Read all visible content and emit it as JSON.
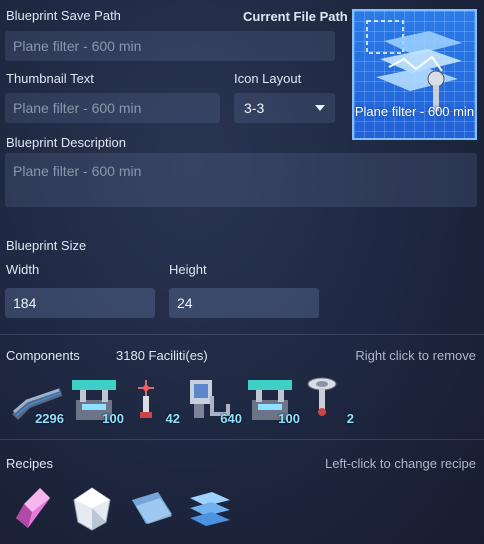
{
  "save_path": {
    "label": "Blueprint Save Path",
    "placeholder": "Plane filter - 600 min"
  },
  "current_file_path": {
    "label": "Current File Path"
  },
  "thumbnail": {
    "label": "Thumbnail Text",
    "placeholder": "Plane filter - 600 min",
    "preview_text": "Plane filter - 600 min"
  },
  "icon_layout": {
    "label": "Icon Layout",
    "value": "3-3"
  },
  "description": {
    "label": "Blueprint Description",
    "placeholder": "Plane filter - 600 min"
  },
  "size": {
    "label": "Blueprint Size",
    "width_label": "Width",
    "width_value": "184",
    "height_label": "Height",
    "height_value": "24"
  },
  "components": {
    "label": "Components",
    "facilities": "3180 Faciliti(es)",
    "hint": "Right click to remove",
    "items": [
      {
        "icon": "conveyor-belt-icon",
        "count": "2296"
      },
      {
        "icon": "sorter-machine-icon",
        "count": "100"
      },
      {
        "icon": "tesla-tower-icon",
        "count": "42"
      },
      {
        "icon": "storage-box-icon",
        "count": "640"
      },
      {
        "icon": "assembler-icon",
        "count": "100"
      },
      {
        "icon": "wireless-tower-icon",
        "count": "2"
      }
    ]
  },
  "recipes": {
    "label": "Recipes",
    "hint": "Left-click to change recipe",
    "items": [
      {
        "icon": "pink-crystal-icon"
      },
      {
        "icon": "white-gem-icon"
      },
      {
        "icon": "glass-plate-icon"
      },
      {
        "icon": "plane-filter-icon"
      }
    ]
  },
  "colors": {
    "accent": "#2a7be8",
    "count": "#8fe0ff"
  }
}
